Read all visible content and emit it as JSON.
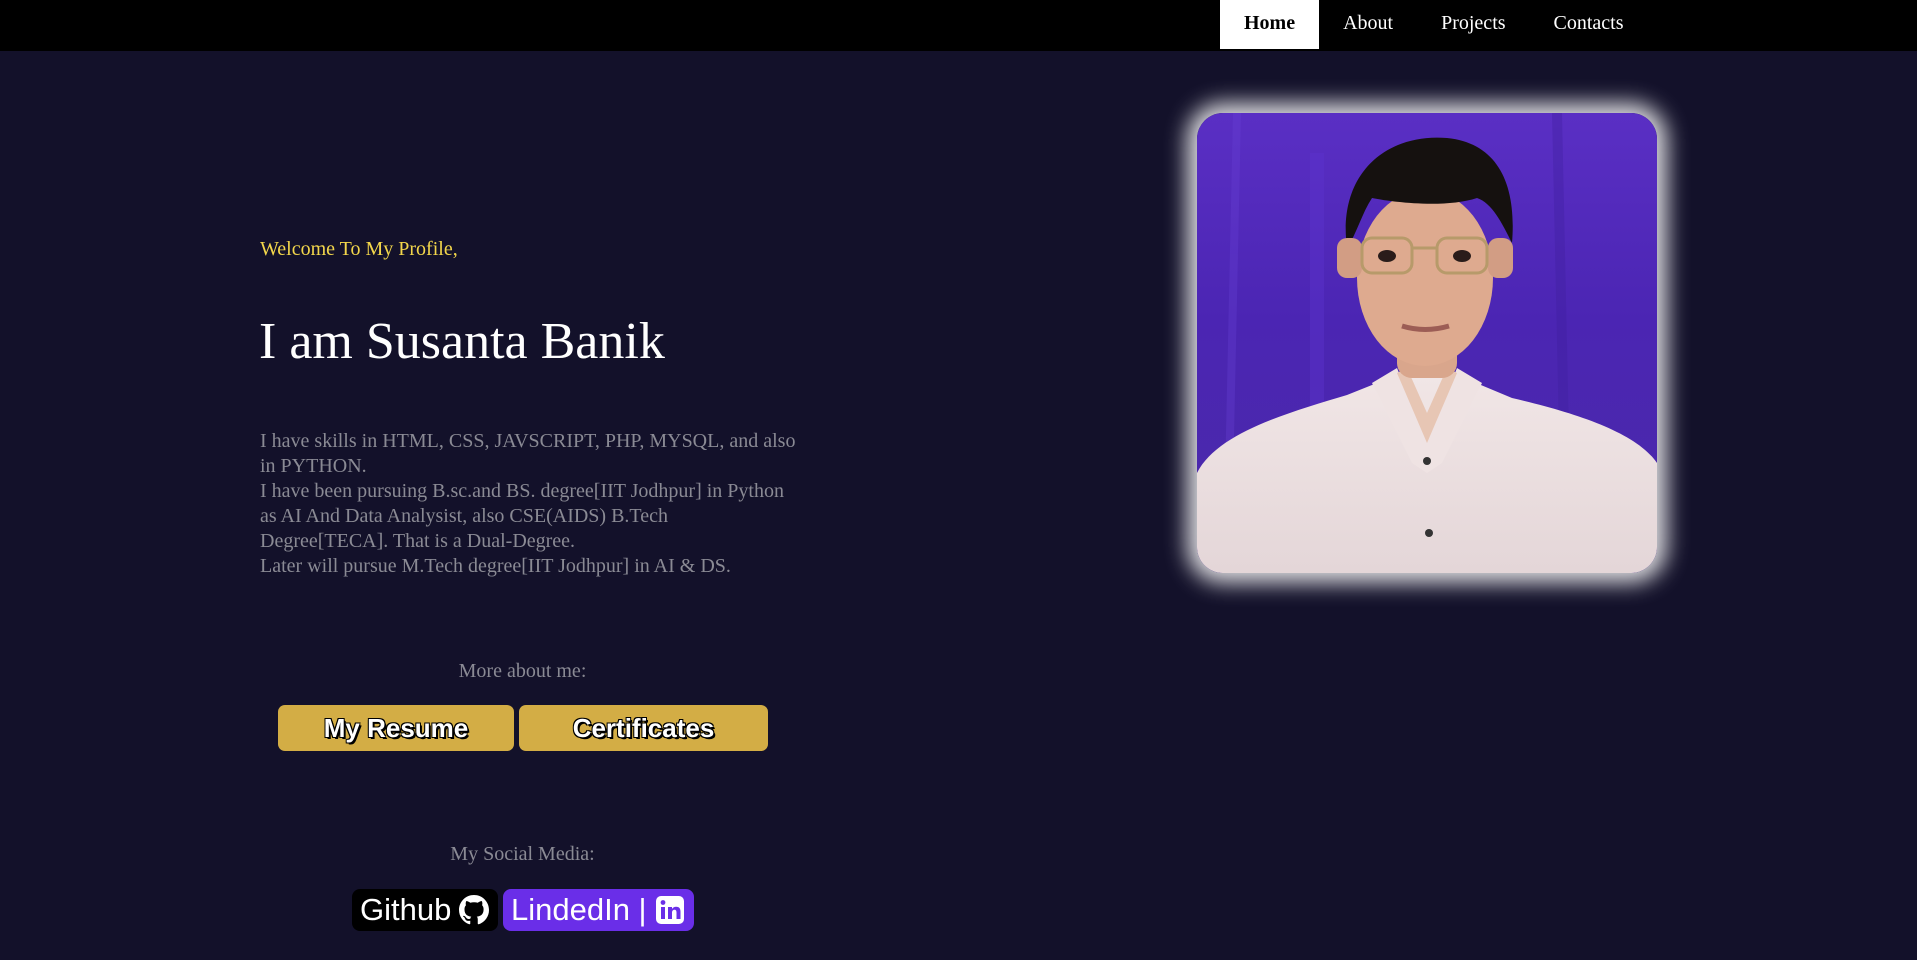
{
  "nav": {
    "items": [
      {
        "label": "Home",
        "active": true
      },
      {
        "label": "About",
        "active": false
      },
      {
        "label": "Projects",
        "active": false
      },
      {
        "label": "Contacts",
        "active": false
      }
    ]
  },
  "hero": {
    "welcome": "Welcome To My Profile,",
    "name": "I am Susanta Banik",
    "bio": [
      "I have skills in HTML, CSS, JAVSCRIPT, PHP, MYSQL, and also in PYTHON.",
      "I have been pursuing B.sc.and BS. degree[IIT Jodhpur] in Python as AI And Data Analysist, also CSE(AIDS) B.Tech Degree[TECA]. That is a Dual-Degree.",
      "Later will pursue M.Tech degree[IIT Jodhpur] in AI & DS."
    ]
  },
  "more": {
    "label": "More about me:",
    "resume_label": "My Resume",
    "certificates_label": "Certificates"
  },
  "social": {
    "label": "My Social Media:",
    "github_label": "Github",
    "github_icon": "github-icon",
    "linkedin_label": "LindedIn |",
    "linkedin_icon": "linkedin-icon"
  },
  "colors": {
    "background": "#13112a",
    "welcome": "#f2d64b",
    "button": "#d3ad45",
    "linkedin": "#6a2ee8"
  }
}
